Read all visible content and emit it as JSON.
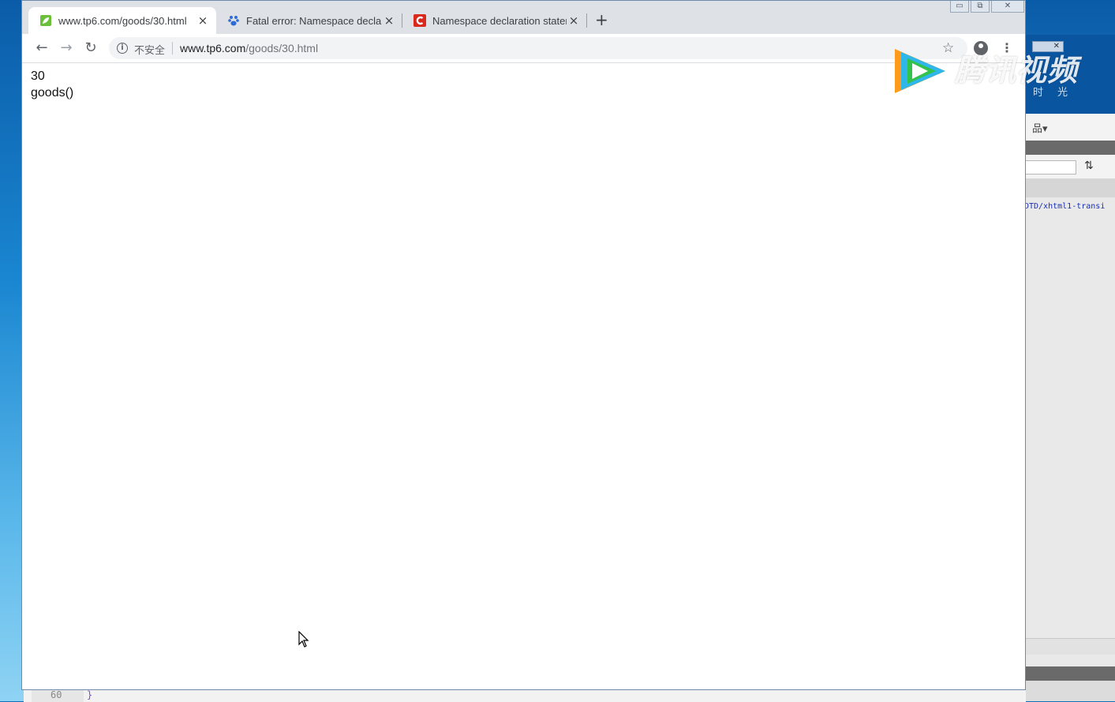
{
  "browser": {
    "tabs": [
      {
        "title": "www.tp6.com/goods/30.html",
        "close": "×",
        "favicon": "tp6-leaf-icon",
        "active": true
      },
      {
        "title": "Fatal error: Namespace declar",
        "close": "×",
        "favicon": "baidu-paw-icon",
        "active": false
      },
      {
        "title": "Namespace declaration staten",
        "close": "×",
        "favicon": "csdn-c-icon",
        "active": false
      }
    ],
    "new_tab": "+",
    "window_controls": {
      "minimize": "▭",
      "restore": "⧉",
      "close": "✕"
    },
    "nav": {
      "back": "←",
      "forward": "→",
      "reload": "↻"
    },
    "omnibox": {
      "security_icon": "i",
      "security_label": "不安全",
      "url_host": "www.tp6.com",
      "url_path": "/goods/30.html"
    },
    "bookmark_star": "☆",
    "menu": "⋮"
  },
  "page": {
    "lines": [
      "30",
      "goods()"
    ]
  },
  "watermark": {
    "text": "腾讯视频",
    "slogan": "不负好时光"
  },
  "background_editor": {
    "code_snippet": "DTD/xhtml1-transi",
    "line_number": "60",
    "brace": "}",
    "sort_icon": "⇅",
    "tree_icon": "品▾",
    "mini_button": "✕"
  }
}
